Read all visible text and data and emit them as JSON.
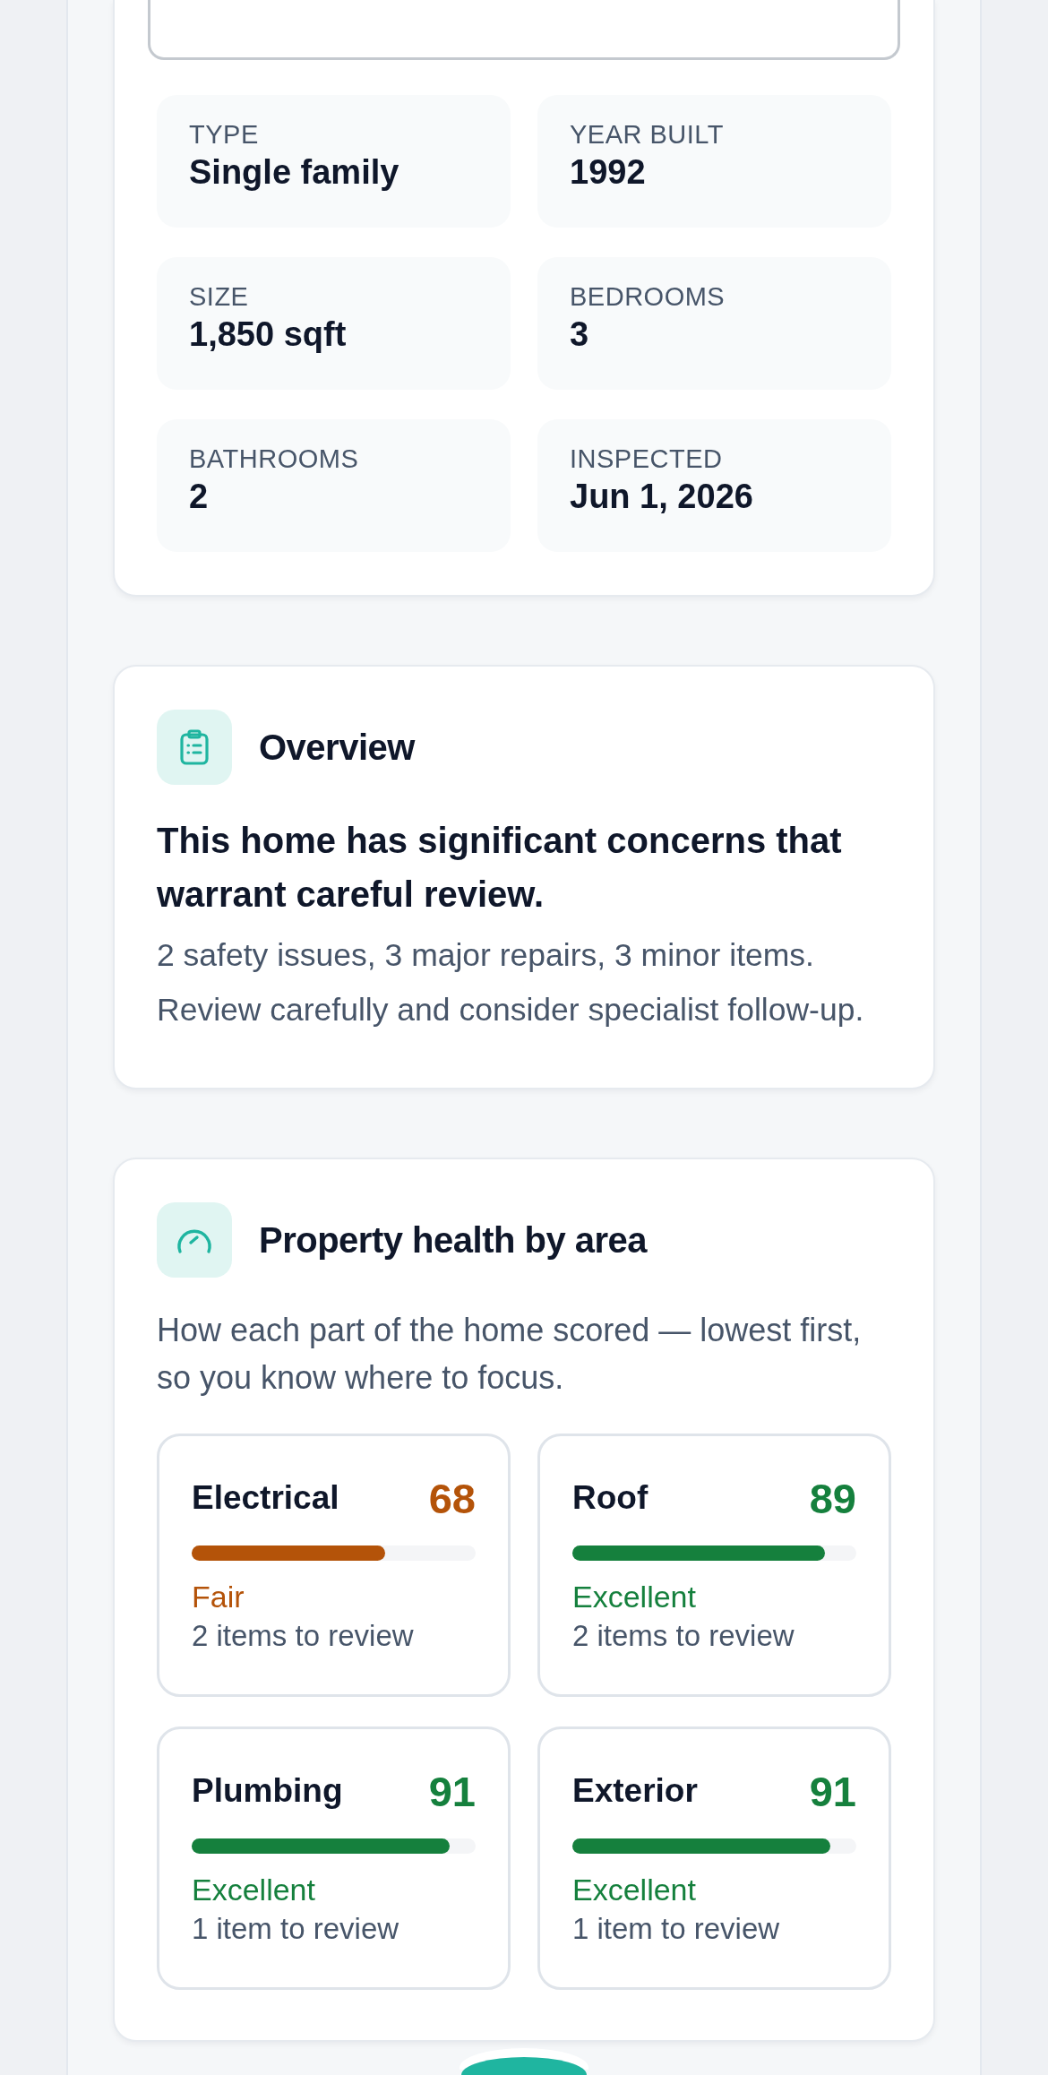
{
  "facts": [
    {
      "label": "TYPE",
      "value": "Single family"
    },
    {
      "label": "YEAR BUILT",
      "value": "1992"
    },
    {
      "label": "SIZE",
      "value": "1,850 sqft"
    },
    {
      "label": "BEDROOMS",
      "value": "3"
    },
    {
      "label": "BATHROOMS",
      "value": "2"
    },
    {
      "label": "INSPECTED",
      "value": "Jun 1, 2026"
    }
  ],
  "overview": {
    "title": "Overview",
    "headline": "This home has significant concerns that warrant careful review.",
    "body": "2 safety issues, 3 major repairs, 3 minor items. Review carefully and consider specialist follow-up."
  },
  "health": {
    "title": "Property health by area",
    "description": "How each part of the home scored — lowest first, so you know where to focus.",
    "areas": [
      {
        "name": "Electrical",
        "score": "68",
        "level": 0.68,
        "rating": "Fair",
        "color": "#b45309",
        "items": "2 items to review"
      },
      {
        "name": "Roof",
        "score": "89",
        "level": 0.89,
        "rating": "Excellent",
        "color": "#15803d",
        "items": "2 items to review"
      },
      {
        "name": "Plumbing",
        "score": "91",
        "level": 0.91,
        "rating": "Excellent",
        "color": "#15803d",
        "items": "1 item to review"
      },
      {
        "name": "Exterior",
        "score": "91",
        "level": 0.91,
        "rating": "Excellent",
        "color": "#15803d",
        "items": "1 item to review"
      }
    ]
  }
}
